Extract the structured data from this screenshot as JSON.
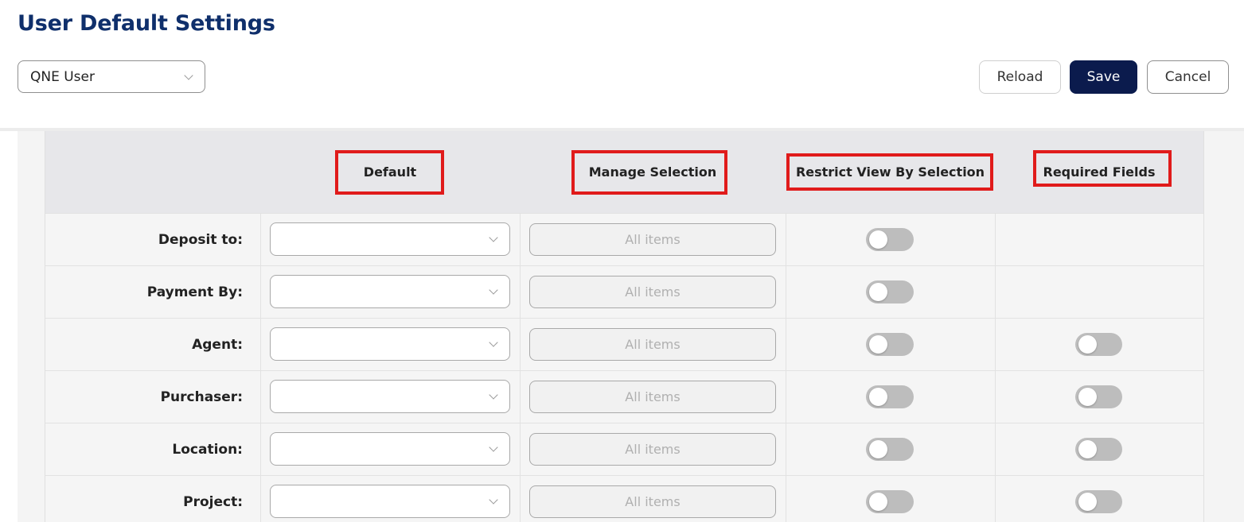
{
  "page": {
    "title": "User Default Settings"
  },
  "user_select": {
    "value": "QNE User"
  },
  "toolbar": {
    "reload_label": "Reload",
    "save_label": "Save",
    "cancel_label": "Cancel"
  },
  "table": {
    "columns": [
      {
        "label": "Default",
        "highlighted": true
      },
      {
        "label": "Manage Selection",
        "highlighted": true
      },
      {
        "label": "Restrict View By Selection",
        "highlighted": true
      },
      {
        "label": "Required Fields",
        "highlighted": true
      }
    ],
    "manage_placeholder": "All items",
    "rows": [
      {
        "label": "Deposit to:",
        "restrict_view": false,
        "has_required": false,
        "required": false
      },
      {
        "label": "Payment By:",
        "restrict_view": false,
        "has_required": false,
        "required": false
      },
      {
        "label": "Agent:",
        "restrict_view": false,
        "has_required": true,
        "required": false
      },
      {
        "label": "Purchaser:",
        "restrict_view": false,
        "has_required": true,
        "required": false
      },
      {
        "label": "Location:",
        "restrict_view": false,
        "has_required": true,
        "required": false
      },
      {
        "label": "Project:",
        "restrict_view": false,
        "has_required": true,
        "required": false
      }
    ]
  },
  "colors": {
    "title": "#0f2f6b",
    "save_button": "#0b1b4d",
    "highlight_border": "#e01b1b",
    "toggle_off": "#bdbdbd",
    "header_bg": "#e7e7ea"
  },
  "icons": {
    "select_arrow": "chevron-down-icon"
  }
}
